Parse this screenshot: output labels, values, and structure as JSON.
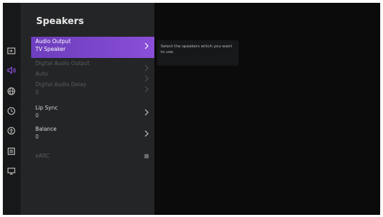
{
  "panel": {
    "title": "Speakers"
  },
  "rail": {
    "icons": [
      "input-icon",
      "sound-icon",
      "globe-icon",
      "clock-icon",
      "accessibility-icon",
      "list-icon",
      "screen-icon"
    ],
    "active_icon": "sound-icon"
  },
  "menu": {
    "items": [
      {
        "label": "Audio Output",
        "value": "TV Speaker",
        "state": "selected"
      },
      {
        "label": "Digital Audio Output",
        "value": "",
        "state": "disabled"
      },
      {
        "label": "Auto",
        "value": "",
        "state": "disabled"
      },
      {
        "label": "Digital Audio Delay",
        "value": "0",
        "state": "disabled"
      },
      {
        "label": "Lip Sync",
        "value": "0",
        "state": "normal"
      },
      {
        "label": "Balance",
        "value": "0",
        "state": "normal"
      },
      {
        "label": "eARC",
        "value": "",
        "state": "disabled-toggle"
      }
    ]
  },
  "hint": {
    "text": "Select the speakers which you want to use."
  },
  "colors": {
    "accent": "#7a45c9",
    "panel": "#242527",
    "rail": "#171819",
    "background": "#0a0b0a"
  }
}
